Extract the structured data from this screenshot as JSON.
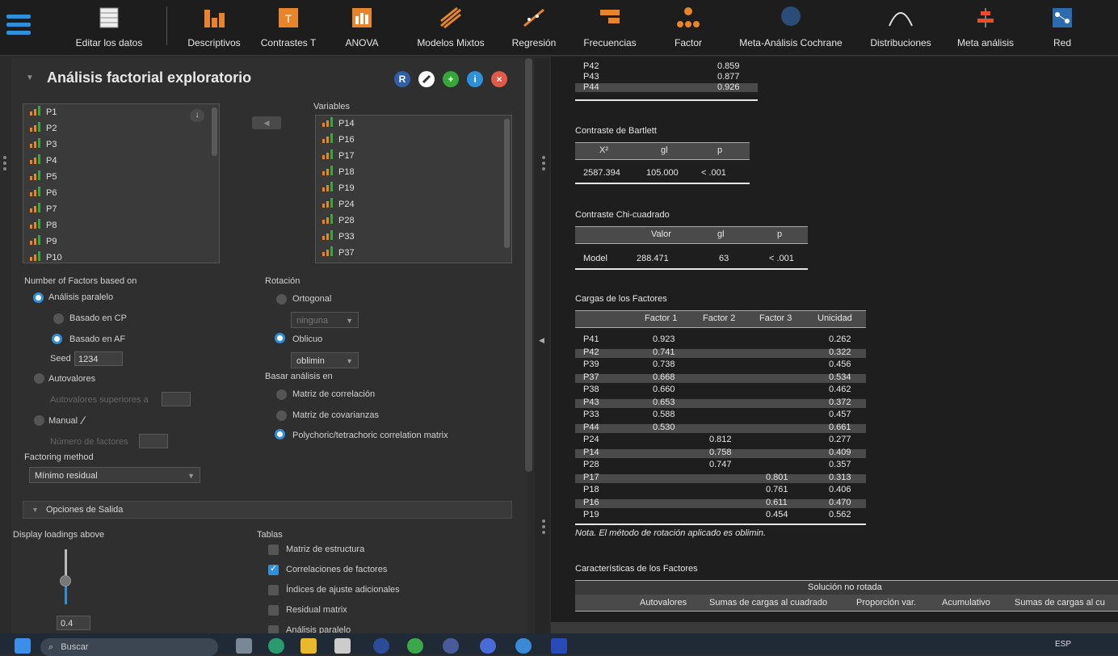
{
  "toolbar": {
    "items": [
      {
        "label": "Editar los datos",
        "icon": "spreadsheet-icon"
      },
      {
        "label": "Descriptivos",
        "icon": "bar-chart-icon"
      },
      {
        "label": "Contrastes T",
        "icon": "t-test-icon"
      },
      {
        "label": "ANOVA",
        "icon": "anova-icon"
      },
      {
        "label": "Modelos Mixtos",
        "icon": "mixed-models-icon"
      },
      {
        "label": "Regresión",
        "icon": "regression-icon"
      },
      {
        "label": "Frecuencias",
        "icon": "frequencies-icon"
      },
      {
        "label": "Factor",
        "icon": "factor-icon"
      },
      {
        "label": "Meta-Análisis Cochrane",
        "icon": "cochrane-icon"
      },
      {
        "label": "Distribuciones",
        "icon": "distributions-icon"
      },
      {
        "label": "Meta análisis",
        "icon": "meta-analysis-icon"
      },
      {
        "label": "Red",
        "icon": "network-icon"
      }
    ]
  },
  "panel": {
    "title": "Análisis factorial exploratorio",
    "header_buttons": [
      "R",
      "",
      "+",
      "i",
      "×"
    ]
  },
  "available_vars": [
    "P1",
    "P2",
    "P3",
    "P4",
    "P5",
    "P6",
    "P7",
    "P8",
    "P9",
    "P10"
  ],
  "variables": {
    "label": "Variables",
    "items": [
      "P14",
      "P16",
      "P17",
      "P18",
      "P19",
      "P24",
      "P28",
      "P33",
      "P37"
    ]
  },
  "nfactors": {
    "label": "Number of Factors based on",
    "parallel": "Análisis paralelo",
    "cp": "Basado en CP",
    "af": "Basado en AF",
    "seed_label": "Seed",
    "seed_value": "1234",
    "eigen": "Autovalores",
    "eigen_above": "Autovalores superiores a",
    "manual": "Manual",
    "num_factors": "Número de factores"
  },
  "rotation": {
    "label": "Rotación",
    "orthogonal": "Ortogonal",
    "orthogonal_select": "ninguna",
    "oblique": "Oblicuo",
    "oblique_select": "oblimin"
  },
  "basis": {
    "label": "Basar análisis en",
    "corr": "Matriz de correlación",
    "cov": "Matriz de covarianzas",
    "poly": "Polychoric/tetrachoric correlation matrix"
  },
  "factoring": {
    "label": "Factoring method",
    "value": "Mínimo residual"
  },
  "output": {
    "header": "Opciones de Salida",
    "display_label": "Display loadings above",
    "display_value": "0.4",
    "display_level": 0.4,
    "tables_label": "Tablas",
    "tables": [
      {
        "label": "Matriz de estructura",
        "checked": false
      },
      {
        "label": "Correlaciones de factores",
        "checked": true
      },
      {
        "label": "Índices de ajuste adicionales",
        "checked": false
      },
      {
        "label": "Residual matrix",
        "checked": false
      },
      {
        "label": "Análisis paralelo",
        "checked": false
      }
    ]
  },
  "results": {
    "top_rows": [
      [
        "P42",
        "0.859"
      ],
      [
        "P43",
        "0.877"
      ],
      [
        "P44",
        "0.926"
      ]
    ],
    "bartlett": {
      "title": "Contraste de Bartlett",
      "headers": [
        "X²",
        "gl",
        "p"
      ],
      "row": [
        "2587.394",
        "105.000",
        "< .001"
      ]
    },
    "chi": {
      "title": "Contraste Chi-cuadrado",
      "headers": [
        "Valor",
        "gl",
        "p"
      ],
      "row": [
        "Model",
        "288.471",
        "63",
        "< .001"
      ]
    },
    "loadings": {
      "title": "Cargas de los Factores",
      "headers": [
        "Factor 1",
        "Factor 2",
        "Factor 3",
        "Unicidad"
      ],
      "rows": [
        [
          "P41",
          "0.923",
          "",
          "",
          "0.262"
        ],
        [
          "P42",
          "0.741",
          "",
          "",
          "0.322"
        ],
        [
          "P39",
          "0.738",
          "",
          "",
          "0.456"
        ],
        [
          "P37",
          "0.668",
          "",
          "",
          "0.534"
        ],
        [
          "P38",
          "0.660",
          "",
          "",
          "0.462"
        ],
        [
          "P43",
          "0.653",
          "",
          "",
          "0.372"
        ],
        [
          "P33",
          "0.588",
          "",
          "",
          "0.457"
        ],
        [
          "P44",
          "0.530",
          "",
          "",
          "0.661"
        ],
        [
          "P24",
          "",
          "0.812",
          "",
          "0.277"
        ],
        [
          "P14",
          "",
          "0.758",
          "",
          "0.409"
        ],
        [
          "P28",
          "",
          "0.747",
          "",
          "0.357"
        ],
        [
          "P17",
          "",
          "",
          "0.801",
          "0.313"
        ],
        [
          "P18",
          "",
          "",
          "0.761",
          "0.406"
        ],
        [
          "P16",
          "",
          "",
          "0.611",
          "0.470"
        ],
        [
          "P19",
          "",
          "",
          "0.454",
          "0.562"
        ]
      ],
      "note": "Nota. El método de rotación aplicado es oblimin."
    },
    "characteristics": {
      "title": "Características de los Factores",
      "span_header": "Solución no rotada",
      "headers": [
        "Autovalores",
        "Sumas de cargas al cuadrado",
        "Proporción var.",
        "Acumulativo",
        "Sumas de cargas al cu"
      ]
    }
  },
  "taskbar": {
    "search": "Buscar",
    "lang": "ESP"
  }
}
